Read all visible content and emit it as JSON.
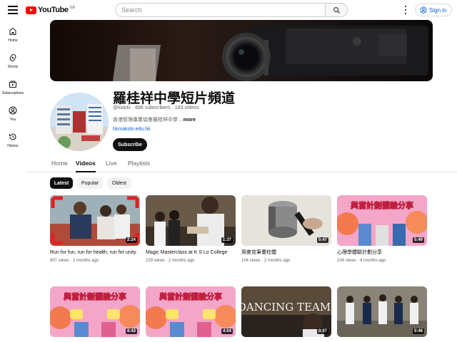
{
  "header": {
    "logo_text": "YouTube",
    "country_code": "GB",
    "search_placeholder": "Search",
    "sign_in_label": "Sign in"
  },
  "sidebar": {
    "items": [
      {
        "label": "Home",
        "icon": "home-icon"
      },
      {
        "label": "Shorts",
        "icon": "shorts-icon"
      },
      {
        "label": "Subscriptions",
        "icon": "subscriptions-icon"
      },
      {
        "label": "You",
        "icon": "you-icon"
      },
      {
        "label": "History",
        "icon": "history-icon"
      }
    ]
  },
  "channel": {
    "name": "羅桂祥中學短片頻道",
    "handle": "@kslotv",
    "subscribers": "686 subscribers",
    "videos": "183 videos",
    "description": "香港管理專業協會羅桂祥中學 ...",
    "more_label": "more",
    "link": "hkmakslo.edu.hk",
    "subscribe_label": "Subscribe"
  },
  "tabs": [
    "Home",
    "Videos",
    "Live",
    "Playlists"
  ],
  "active_tab": "Videos",
  "chips": [
    "Latest",
    "Popular",
    "Oldest"
  ],
  "active_chip": "Latest",
  "videos": [
    {
      "title": "Run for fun, run for health, run for unity.",
      "views": "807 views",
      "age": "2 months ago",
      "duration": "2:24"
    },
    {
      "title": "Magic Masterclass at K S Lo College",
      "views": "229 views",
      "age": "2 months ago",
      "duration": "1:37"
    },
    {
      "title": "用麥克筆畫柱體",
      "views": "104 views",
      "age": "2 months ago",
      "duration": "5:47"
    },
    {
      "title": "心理學體驗計劃分享",
      "views": "104 views",
      "age": "4 months ago",
      "duration": "5:49"
    },
    {
      "title": "",
      "views": "",
      "age": "",
      "duration": "8:43",
      "overlay": "與當計劃體驗分享"
    },
    {
      "title": "",
      "views": "",
      "age": "",
      "duration": "4:04",
      "overlay": "與當計劃體驗分享"
    },
    {
      "title": "",
      "views": "",
      "age": "",
      "duration": "0:37",
      "overlay": "DANCING TEAM"
    },
    {
      "title": "",
      "views": "",
      "age": "",
      "duration": "0:46"
    }
  ],
  "thumb_overlays": {
    "psych": "與當計劃體驗分享",
    "dance": "DANCING TEAM"
  },
  "colors": {
    "brand_red": "#ff0000",
    "link_blue": "#065fd4",
    "text": "#0f0f0f",
    "secondary_text": "#606060"
  }
}
